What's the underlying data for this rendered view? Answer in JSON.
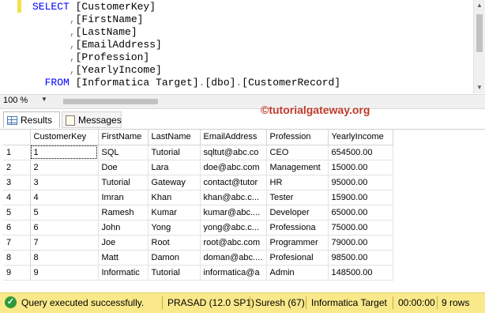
{
  "editor": {
    "lines": [
      [
        {
          "t": "SELECT ",
          "c": "kw"
        },
        {
          "t": "[CustomerKey]",
          "c": "tx"
        }
      ],
      [
        {
          "t": "      ,",
          "c": "gr"
        },
        {
          "t": "[FirstName]",
          "c": "tx"
        }
      ],
      [
        {
          "t": "      ,",
          "c": "gr"
        },
        {
          "t": "[LastName]",
          "c": "tx"
        }
      ],
      [
        {
          "t": "      ,",
          "c": "gr"
        },
        {
          "t": "[EmailAddress]",
          "c": "tx"
        }
      ],
      [
        {
          "t": "      ,",
          "c": "gr"
        },
        {
          "t": "[Profession]",
          "c": "tx"
        }
      ],
      [
        {
          "t": "      ,",
          "c": "gr"
        },
        {
          "t": "[YearlyIncome]",
          "c": "tx"
        }
      ],
      [
        {
          "t": "  FROM ",
          "c": "kw"
        },
        {
          "t": "[Informatica Target]",
          "c": "tx"
        },
        {
          "t": ".",
          "c": "gr"
        },
        {
          "t": "[dbo]",
          "c": "tx"
        },
        {
          "t": ".",
          "c": "gr"
        },
        {
          "t": "[CustomerRecord]",
          "c": "tx"
        }
      ]
    ]
  },
  "zoom": {
    "value": "100 %"
  },
  "watermark": "©tutorialgateway.org",
  "tabs": {
    "results": "Results",
    "messages": "Messages"
  },
  "grid": {
    "columns": [
      "CustomerKey",
      "FirstName",
      "LastName",
      "EmailAddress",
      "Profession",
      "YearlyIncome"
    ],
    "rows": [
      [
        "1",
        "SQL",
        "Tutorial",
        "sqltut@abc.co",
        "CEO",
        "654500.00"
      ],
      [
        "2",
        "Doe",
        "Lara",
        "doe@abc.com",
        "Management",
        "15000.00"
      ],
      [
        "3",
        "Tutorial",
        "Gateway",
        "contact@tutor",
        "HR",
        "95000.00"
      ],
      [
        "4",
        "Imran",
        "Khan",
        "khan@abc.c...",
        "Tester",
        "15900.00"
      ],
      [
        "5",
        "Ramesh",
        "Kumar",
        "kumar@abc....",
        "Developer",
        "65000.00"
      ],
      [
        "6",
        "John",
        "Yong",
        "yong@abc.c...",
        "Professiona",
        "75000.00"
      ],
      [
        "7",
        "Joe",
        "Root",
        "root@abc.com",
        "Programmer",
        "79000.00"
      ],
      [
        "8",
        "Matt",
        "Damon",
        "doman@abc....",
        "Profesional",
        "98500.00"
      ],
      [
        "9",
        "Informatic",
        "Tutorial",
        "informatica@a",
        "Admin",
        "148500.00"
      ]
    ]
  },
  "status": {
    "message": "Query executed successfully.",
    "server": "PRASAD (12.0 SP1)",
    "user": "Suresh (67)",
    "database": "Informatica Target",
    "elapsed": "00:00:00",
    "rows": "9 rows"
  },
  "colors": {
    "status_bg": "#f9e98a",
    "keyword": "#0000ff",
    "watermark": "#c0392b"
  }
}
